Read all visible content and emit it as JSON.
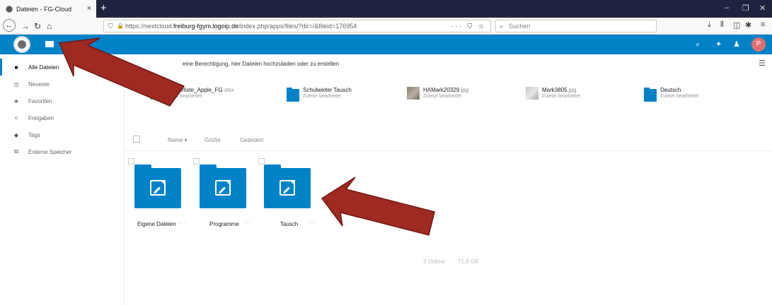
{
  "browser": {
    "tab_title": "Dateien - FG-Cloud",
    "tab_close": "×",
    "new_tab": "+",
    "window_controls": [
      "–",
      "❐",
      "✕"
    ],
    "url_prefix": "https://nextcloud.",
    "url_domain": "freiburg-fgym.logoip.de",
    "url_path": "/index.php/apps/files/?dir=/&fileid=176954",
    "url_actions": "··· ⛉ ☆",
    "search_placeholder": "Suchen"
  },
  "header": {
    "avatar_initial": "P",
    "accent_color": "#0082c9"
  },
  "sidebar": {
    "items": [
      {
        "label": "Alle Dateien",
        "icon": "folder-icon",
        "glyph": "■"
      },
      {
        "label": "Neueste",
        "icon": "clock-icon",
        "glyph": "◷"
      },
      {
        "label": "Favoriten",
        "icon": "star-icon",
        "glyph": "★"
      },
      {
        "label": "Freigaben",
        "icon": "share-icon",
        "glyph": "<"
      },
      {
        "label": "Tags",
        "icon": "tag-icon",
        "glyph": "◆"
      },
      {
        "label": "Externe Speicher",
        "icon": "external-storage-icon",
        "glyph": "⧉"
      }
    ]
  },
  "main": {
    "notice": "eine Berechtigung, hier Dateien hochzuladen oder zu erstellen",
    "recent": [
      {
        "name": "Inventarliste_Apple_FG",
        "ext": ".xlsx",
        "sub": "Zuletzt bearbeitet",
        "icon": "spreadsheet-icon"
      },
      {
        "name": "Schulweiter Tausch",
        "ext": "",
        "sub": "Zuletzt bearbeitet",
        "icon": "folder-icon"
      },
      {
        "name": "HAMark20329",
        "ext": ".jpg",
        "sub": "Zuletzt bearbeitet",
        "icon": "image-icon"
      },
      {
        "name": "Mark3805",
        "ext": ".jpg",
        "sub": "Zuletzt bearbeitet",
        "icon": "image-icon"
      },
      {
        "name": "Deutsch",
        "ext": "",
        "sub": "Zuletzt bearbeitet",
        "icon": "folder-icon"
      }
    ],
    "columns": {
      "name": "Name",
      "sort_arrow": "▾",
      "size": "Größe",
      "modified": "Geändert"
    },
    "folders": [
      {
        "name": "Eigene Dateien"
      },
      {
        "name": "Programme"
      },
      {
        "name": "Tausch"
      }
    ],
    "more_glyph": "···",
    "summary": {
      "folders": "3 Ordner",
      "size": "71,9 GB"
    }
  }
}
